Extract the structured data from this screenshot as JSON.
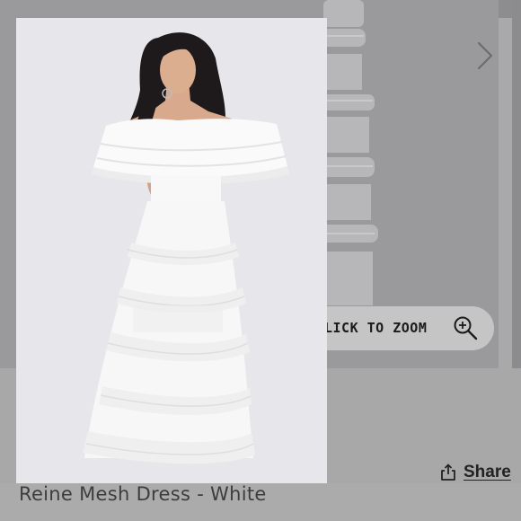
{
  "gallery": {
    "next_icon": "chevron-right-icon",
    "zoom_label": "LICK TO ZOOM",
    "zoom_icon": "zoom-in-icon",
    "photo_alt": "Model wearing white off-shoulder tiered mesh dress"
  },
  "actions": {
    "share_icon": "share-icon",
    "share_label": "Share"
  },
  "product": {
    "title": "Reine Mesh Dress - White"
  },
  "colors": {
    "overlay": "#a9a9aa",
    "photo_background": "#e7e6ea",
    "text": "#222222"
  }
}
